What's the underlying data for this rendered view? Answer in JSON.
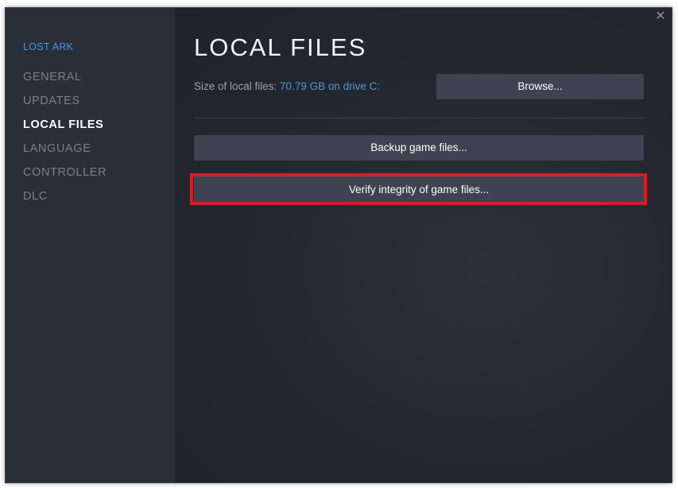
{
  "sidebar": {
    "game_title": "LOST ARK",
    "items": [
      {
        "label": "GENERAL"
      },
      {
        "label": "UPDATES"
      },
      {
        "label": "LOCAL FILES",
        "active": true
      },
      {
        "label": "LANGUAGE"
      },
      {
        "label": "CONTROLLER"
      },
      {
        "label": "DLC"
      }
    ]
  },
  "main": {
    "title": "LOCAL FILES",
    "size_label": "Size of local files: ",
    "size_value": "70.79 GB on drive C:",
    "browse_label": "Browse...",
    "backup_label": "Backup game files...",
    "verify_label": "Verify integrity of game files..."
  },
  "window": {
    "close_icon": "close-icon",
    "close_glyph": "✕"
  },
  "colors": {
    "accent": "#4f94e0",
    "highlight": "#d31f27",
    "button_bg": "#3d4350",
    "sidebar_bg": "#2a2e36",
    "content_bg": "#23262e"
  }
}
